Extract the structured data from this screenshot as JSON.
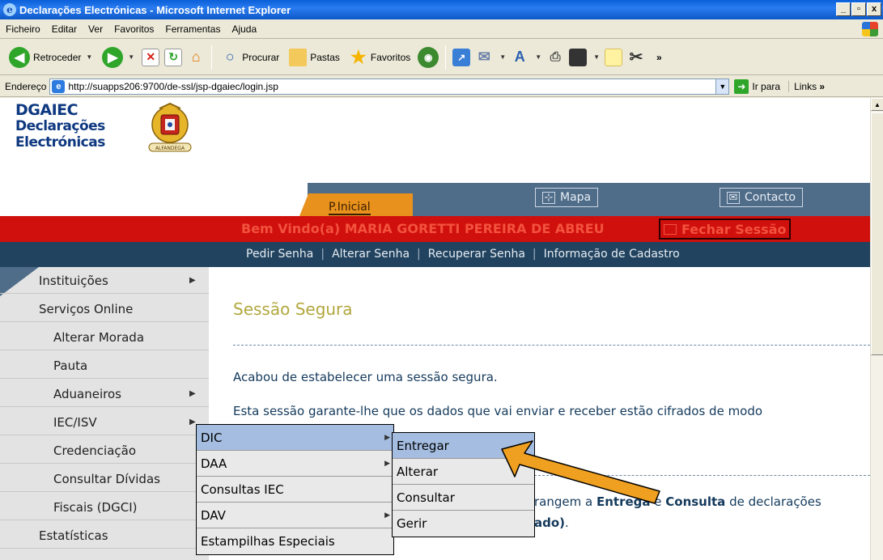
{
  "window": {
    "title": "Declarações Electrónicas - Microsoft Internet Explorer",
    "controls": [
      "_",
      "▫",
      "x"
    ]
  },
  "menubar": [
    "Ficheiro",
    "Editar",
    "Ver",
    "Favoritos",
    "Ferramentas",
    "Ajuda"
  ],
  "toolbar": {
    "back_label": "Retroceder",
    "search_label": "Procurar",
    "folders_label": "Pastas",
    "favorites_label": "Favoritos"
  },
  "address": {
    "label": "Endereço",
    "url": "http://suapps206:9700/de-ssl/jsp-dgaiec/login.jsp",
    "go_label": "Ir para",
    "links_label": "Links"
  },
  "site": {
    "brand_line1": "DGAIEC",
    "brand_line2": "Declarações",
    "brand_line3": "Electrónicas",
    "crest_text": "ALFANDEGA",
    "tab_home": "P.Inicial",
    "tab_map": "Mapa",
    "tab_contact": "Contacto",
    "welcome": "Bem Vindo(a) MARIA GORETTI PEREIRA DE ABREU",
    "logout": "Fechar Sessão",
    "nav_links": [
      "Pedir Senha",
      "Alterar Senha",
      "Recuperar Senha",
      "Informação de Cadastro"
    ],
    "nav_sep": "|"
  },
  "sidebar": [
    {
      "label": "Instituições",
      "has_sub": true,
      "indent": false
    },
    {
      "label": "Serviços Online",
      "has_sub": false,
      "indent": false
    },
    {
      "label": "Alterar Morada",
      "has_sub": false,
      "indent": true
    },
    {
      "label": "Pauta",
      "has_sub": false,
      "indent": true
    },
    {
      "label": "Aduaneiros",
      "has_sub": true,
      "indent": true
    },
    {
      "label": "IEC/ISV",
      "has_sub": true,
      "indent": true
    },
    {
      "label": "Credenciação",
      "has_sub": false,
      "indent": true
    },
    {
      "label": "Consultar Dívidas",
      "has_sub": false,
      "indent": true
    },
    {
      "label": "Fiscais (DGCI)",
      "has_sub": false,
      "indent": true
    },
    {
      "label": "Estatísticas",
      "has_sub": false,
      "indent": false
    }
  ],
  "content": {
    "title": "Sessão Segura",
    "para1": "Acabou de estabelecer uma sessão segura.",
    "para2": "Esta sessão garante-lhe que os dados que vai enviar e receber estão cifrados de modo",
    "para3_pre": "rangem a ",
    "para3_b1": "Entrega",
    "para3_mid": " e ",
    "para3_b2": "Consulta",
    "para3_post": " de declarações",
    "para4_b": "ado)",
    "para4_post": "."
  },
  "menu_iec": [
    {
      "label": "DIC",
      "has_sub": true,
      "selected": true
    },
    {
      "label": "DAA",
      "has_sub": true,
      "selected": false
    },
    {
      "label": "Consultas IEC",
      "has_sub": false,
      "selected": false
    },
    {
      "label": "DAV",
      "has_sub": true,
      "selected": false
    },
    {
      "label": "Estampilhas Especiais",
      "has_sub": false,
      "selected": false
    }
  ],
  "menu_dic": [
    {
      "label": "Entregar",
      "selected": true
    },
    {
      "label": "Alterar",
      "selected": false
    },
    {
      "label": "Consultar",
      "selected": false
    },
    {
      "label": "Gerir",
      "selected": false
    }
  ],
  "colors": {
    "callout_arrow": "#f0a020",
    "red_bar": "#d0100d",
    "nav_bar": "#22435f",
    "tab_home": "#e8921d"
  }
}
